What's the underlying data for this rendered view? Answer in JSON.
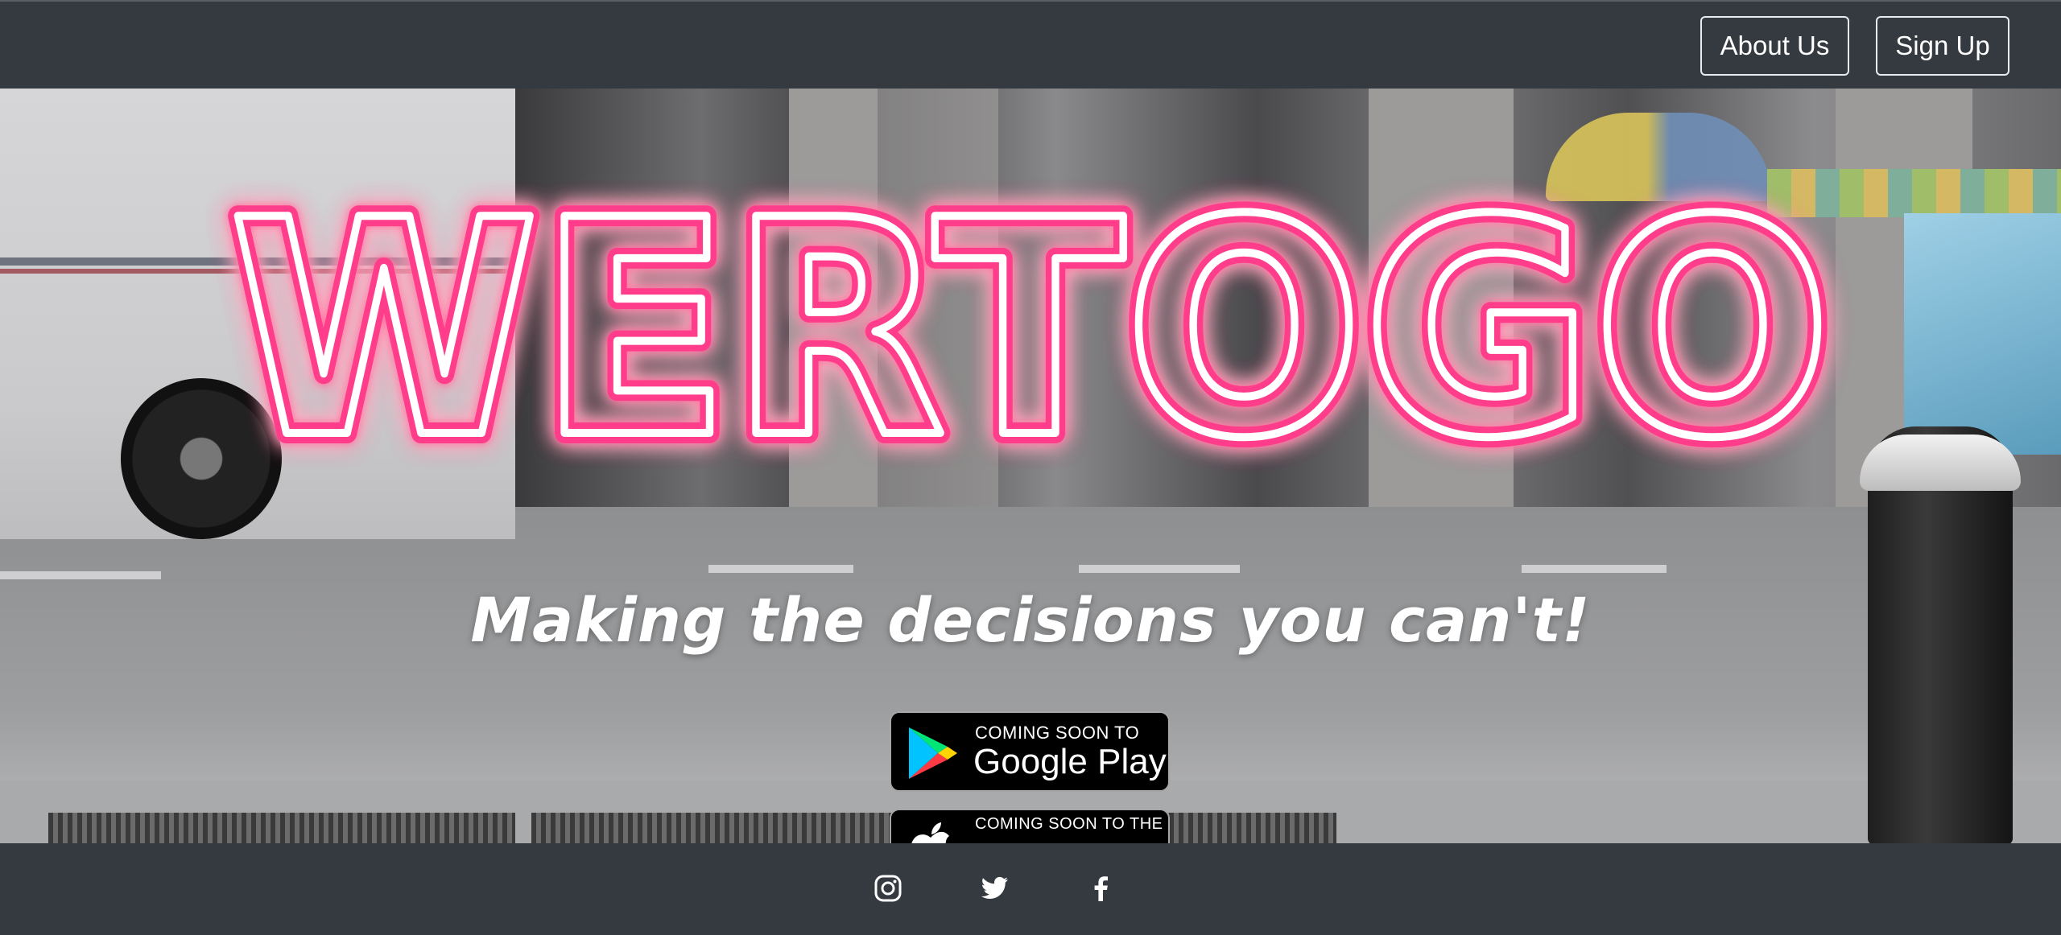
{
  "nav": {
    "about_label": "About Us",
    "signup_label": "Sign Up"
  },
  "hero": {
    "logo_text": "WERTOGO",
    "tagline": "Making the decisions you can't!"
  },
  "store_badges": {
    "google": {
      "small": "COMING SOON TO",
      "big": "Google Play"
    },
    "apple": {
      "small": "COMING SOON TO THE"
    }
  },
  "footer": {
    "icons": [
      "instagram-icon",
      "twitter-icon",
      "facebook-icon"
    ]
  },
  "colors": {
    "navbar": "#343a40",
    "neon": "#ff3d8b",
    "text": "#ffffff"
  }
}
